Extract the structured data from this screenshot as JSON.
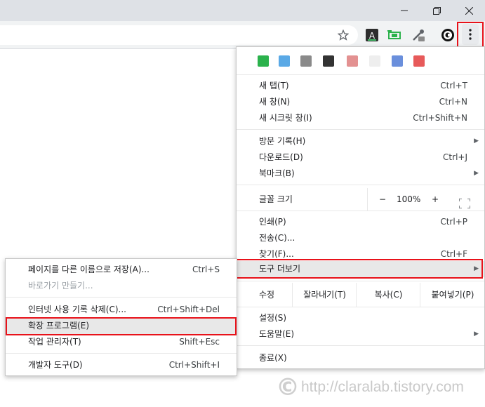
{
  "window": {
    "minimize_icon": "minimize-icon",
    "maximize_icon": "restore-icon",
    "close_icon": "close-icon"
  },
  "toolbar": {
    "icons": [
      "star-icon",
      "extension-a-icon",
      "extension-capture-icon",
      "eyedropper-icon",
      "extension-c-icon",
      "kebab-menu-icon"
    ]
  },
  "menu": {
    "new_tab": {
      "label": "새 탭(T)",
      "shortcut": "Ctrl+T"
    },
    "new_window": {
      "label": "새 창(N)",
      "shortcut": "Ctrl+N"
    },
    "new_incognito": {
      "label": "새 시크릿 창(I)",
      "shortcut": "Ctrl+Shift+N"
    },
    "history": {
      "label": "방문 기록(H)"
    },
    "downloads": {
      "label": "다운로드(D)",
      "shortcut": "Ctrl+J"
    },
    "bookmarks": {
      "label": "북마크(B)"
    },
    "zoom": {
      "label": "글꼴 크기",
      "minus": "−",
      "value": "100%",
      "plus": "+"
    },
    "print": {
      "label": "인쇄(P)",
      "shortcut": "Ctrl+P"
    },
    "cast": {
      "label": "전송(C)..."
    },
    "find": {
      "label": "찾기(F)...",
      "shortcut": "Ctrl+F"
    },
    "more_tools": {
      "label": "도구 더보기"
    },
    "edit": {
      "label": "수정",
      "cut": "잘라내기(T)",
      "copy": "복사(C)",
      "paste": "붙여넣기(P)"
    },
    "settings": {
      "label": "설정(S)"
    },
    "help": {
      "label": "도움말(E)"
    },
    "exit": {
      "label": "종료(X)"
    }
  },
  "submenu": {
    "save_page": {
      "label": "페이지를 다른 이름으로 저장(A)...",
      "shortcut": "Ctrl+S"
    },
    "create_shortcut": {
      "label": "바로가기 만들기..."
    },
    "clear_data": {
      "label": "인터넷 사용 기록 삭제(C)...",
      "shortcut": "Ctrl+Shift+Del"
    },
    "extensions": {
      "label": "확장 프로그램(E)"
    },
    "task_manager": {
      "label": "작업 관리자(T)",
      "shortcut": "Shift+Esc"
    },
    "dev_tools": {
      "label": "개발자 도구(D)",
      "shortcut": "Ctrl+Shift+I"
    }
  },
  "watermark": {
    "text": "http://claralab.tistory.com"
  },
  "colors": {
    "highlight_border": "#e8121a",
    "swatches": [
      "#2bb24c",
      "#5aa9e6",
      "#8a8a8a",
      "#333333",
      "#e39191",
      "#eeeeee",
      "#6a8fdc",
      "#e75a5a"
    ]
  }
}
